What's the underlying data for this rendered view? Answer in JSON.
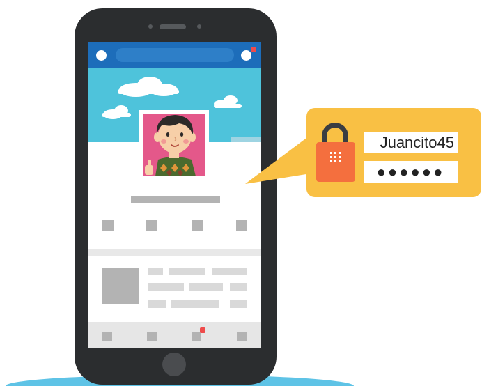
{
  "login_bubble": {
    "username": "Juancito45",
    "password_mask": "●●●●●●"
  },
  "icons": {
    "lock": "padlock-icon",
    "avatar": "profile-avatar-icon"
  },
  "colors": {
    "topbar": "#1d6dba",
    "cover_sky": "#4ec3db",
    "bubble": "#f9c044",
    "lock_body": "#f46f3e",
    "notification": "#ef4b4b",
    "avatar_bg": "#e4588a",
    "phone_body": "#2b2d2f"
  }
}
